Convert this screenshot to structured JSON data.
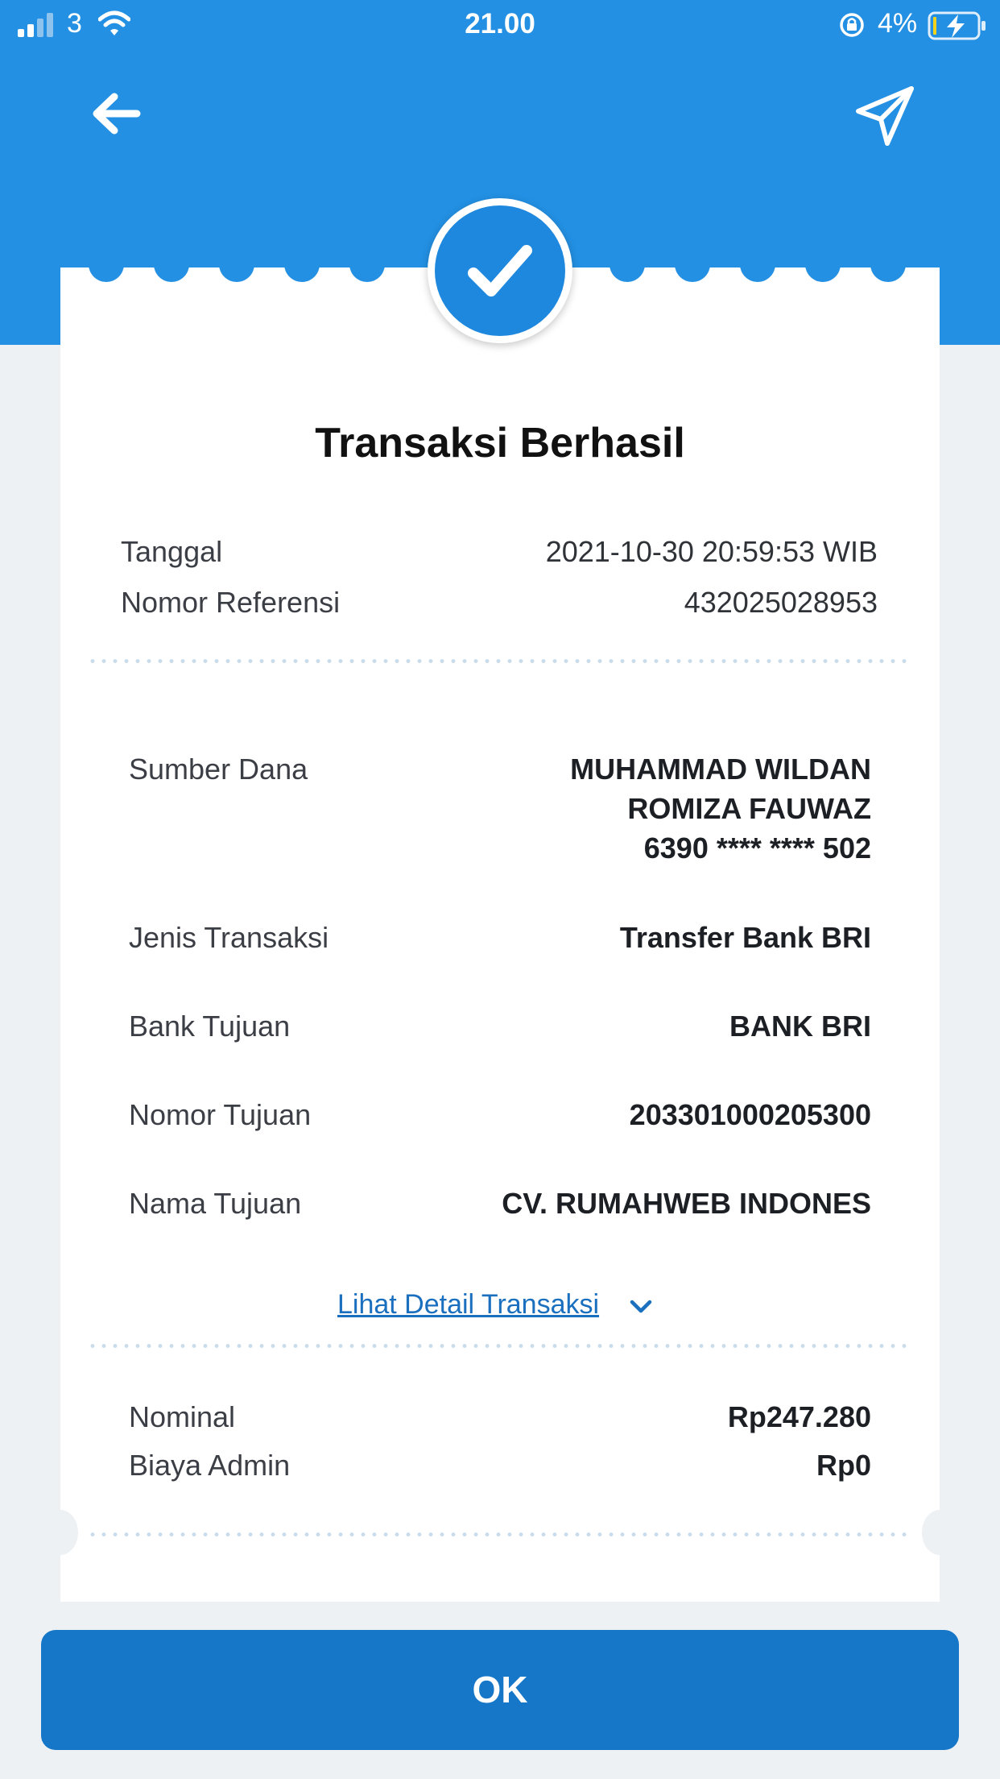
{
  "status_bar": {
    "carrier": "3",
    "time": "21.00",
    "battery": "4%"
  },
  "header": {
    "back_icon": "arrow-left-icon",
    "share_icon": "paper-plane-icon",
    "accent_color": "#2390e3"
  },
  "receipt": {
    "status_icon": "checkmark-icon",
    "title": "Transaksi Berhasil",
    "date_label": "Tanggal",
    "date_value": "2021-10-30 20:59:53 WIB",
    "ref_label": "Nomor Referensi",
    "ref_value": "432025028953",
    "details": [
      {
        "label": "Sumber Dana",
        "value_lines": [
          "MUHAMMAD WILDAN",
          "ROMIZA FAUWAZ",
          "6390 **** **** 502"
        ]
      },
      {
        "label": "Jenis Transaksi",
        "value": "Transfer Bank BRI"
      },
      {
        "label": "Bank Tujuan",
        "value": "BANK BRI"
      },
      {
        "label": "Nomor Tujuan",
        "value": "203301000205300"
      },
      {
        "label": "Nama Tujuan",
        "value": "CV. RUMAHWEB INDONES"
      }
    ],
    "detail_link": "Lihat Detail Transaksi",
    "amounts": [
      {
        "label": "Nominal",
        "value": "Rp247.280"
      },
      {
        "label": "Biaya Admin",
        "value": "Rp0"
      }
    ]
  },
  "ok_button": "OK"
}
